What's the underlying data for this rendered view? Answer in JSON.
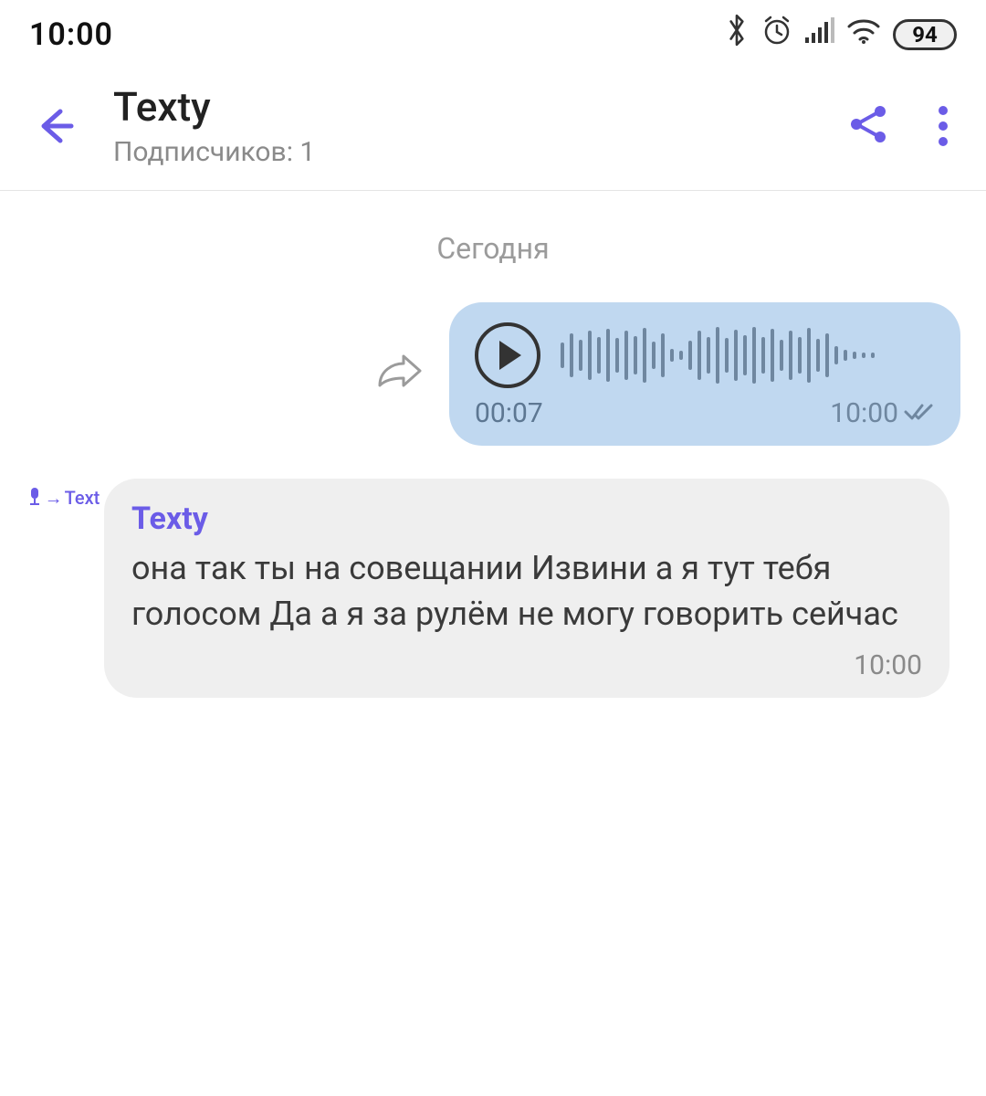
{
  "status": {
    "time": "10:00",
    "battery": "94"
  },
  "header": {
    "title": "Texty",
    "subtitle": "Подписчиков: 1"
  },
  "chat": {
    "date_label": "Сегодня",
    "voice_msg": {
      "duration": "00:07",
      "sent_time": "10:00"
    },
    "text_msg": {
      "sender": "Texty",
      "body": "она так ты на совещании Извини а я тут тебя голосом Да а я за рулём не могу говорить сейчас",
      "time": "10:00",
      "avatar_label": "Text"
    }
  }
}
